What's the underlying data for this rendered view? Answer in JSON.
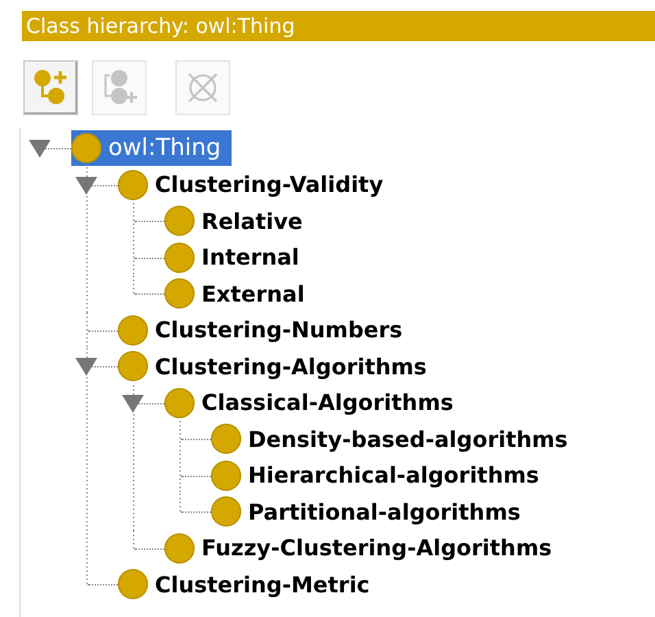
{
  "panel": {
    "title": "Class hierarchy: owl:Thing"
  },
  "toolbar": [
    {
      "kind": "add-subclass",
      "disabled": false
    },
    {
      "kind": "add-sibling",
      "disabled": true
    },
    {
      "kind": "delete",
      "disabled": true
    }
  ],
  "tree": [
    {
      "label": "owl:Thing",
      "bold": false,
      "selected": true,
      "expanded": true,
      "children": [
        {
          "label": "Clustering-Validity",
          "bold": true,
          "selected": false,
          "expanded": true,
          "children": [
            {
              "label": "Relative",
              "bold": true,
              "selected": false
            },
            {
              "label": "Internal",
              "bold": true,
              "selected": false
            },
            {
              "label": "External",
              "bold": true,
              "selected": false
            }
          ]
        },
        {
          "label": "Clustering-Numbers",
          "bold": true,
          "selected": false
        },
        {
          "label": "Clustering-Algorithms",
          "bold": true,
          "selected": false,
          "expanded": true,
          "children": [
            {
              "label": "Classical-Algorithms",
              "bold": true,
              "selected": false,
              "expanded": true,
              "children": [
                {
                  "label": "Density-based-algorithms",
                  "bold": true,
                  "selected": false
                },
                {
                  "label": "Hierarchical-algorithms",
                  "bold": true,
                  "selected": false
                },
                {
                  "label": "Partitional-algorithms",
                  "bold": true,
                  "selected": false
                }
              ]
            },
            {
              "label": "Fuzzy-Clustering-Algorithms",
              "bold": true,
              "selected": false
            }
          ]
        },
        {
          "label": "Clustering-Metric",
          "bold": true,
          "selected": false
        }
      ]
    }
  ]
}
